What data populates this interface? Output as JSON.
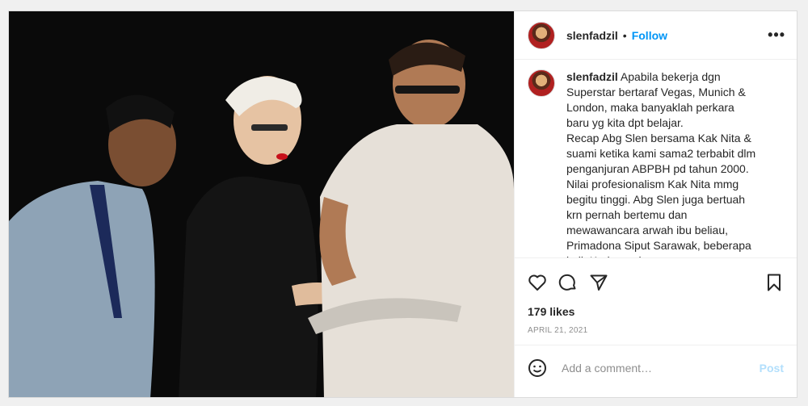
{
  "post": {
    "username": "slenfadzil",
    "separator": "•",
    "follow_label": "Follow",
    "more_icon": "more-horizontal-icon",
    "caption": {
      "username": "slenfadzil",
      "text": " Apabila bekerja dgn Superstar bertaraf Vegas, Munich & London, maka banyaklah perkara baru yg kita dpt belajar.\nRecap Abg Slen bersama Kak Nita & suami ketika kami sama2 terbabit dlm penganjuran ABPBH pd tahun 2000. Nilai profesionalism Kak Nita mmg begitu tinggi. Abg Slen juga bertuah krn pernah bertemu dan mewawancara arwah ibu beliau, Primadona Siput Sarawak, beberapa kali. Kedua mrk"
    },
    "likes": "179 likes",
    "date": "APRIL 21, 2021",
    "comment_placeholder": "Add a comment…",
    "post_label": "Post",
    "icons": [
      "heart-icon",
      "comment-icon",
      "share-icon",
      "bookmark-icon",
      "emoji-icon"
    ],
    "colors": {
      "link": "#0095f6",
      "post_disabled": "#b2dffc",
      "meta": "#8e8e8e"
    }
  }
}
